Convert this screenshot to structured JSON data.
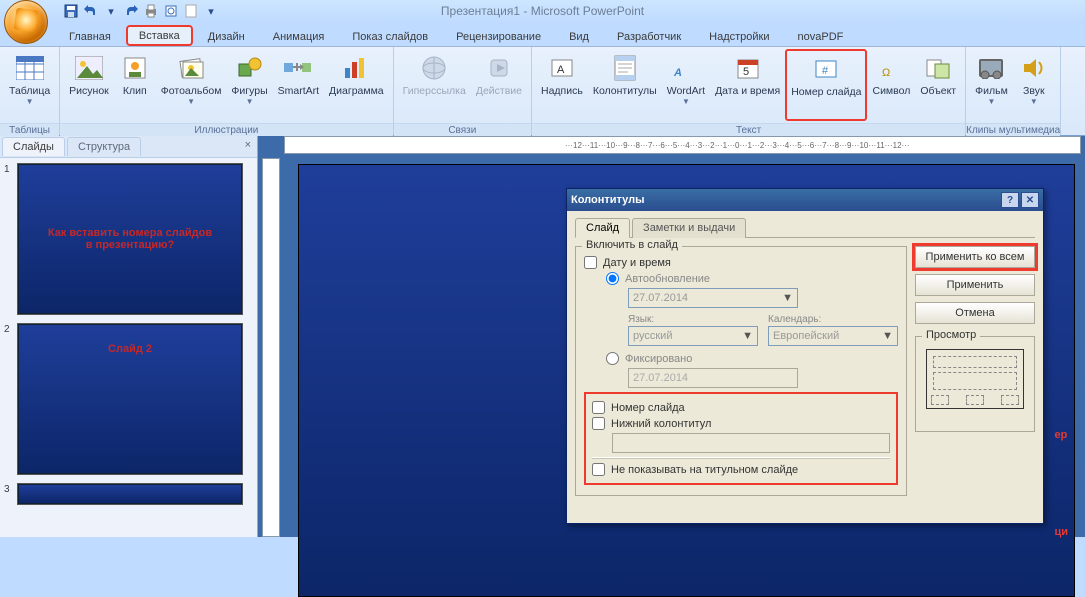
{
  "app_title": "Презентация1 - Microsoft PowerPoint",
  "tabs": {
    "home": "Главная",
    "insert": "Вставка",
    "design": "Дизайн",
    "anim": "Анимация",
    "show": "Показ слайдов",
    "review": "Рецензирование",
    "view": "Вид",
    "dev": "Разработчик",
    "addins": "Надстройки",
    "nova": "novaPDF"
  },
  "groups": {
    "tables": "Таблицы",
    "illust": "Иллюстрации",
    "links": "Связи",
    "text": "Текст",
    "media": "Клипы мультимедиа"
  },
  "ribbon": {
    "table": "Таблица",
    "picture": "Рисунок",
    "clip": "Клип",
    "album": "Фотоальбом",
    "shapes": "Фигуры",
    "smartart": "SmartArt",
    "chart": "Диаграмма",
    "hyperlink": "Гиперссылка",
    "action": "Действие",
    "textbox": "Надпись",
    "headerfooter": "Колонтитулы",
    "wordart": "WordArt",
    "datetime": "Дата и время",
    "slidenum": "Номер слайда",
    "symbol": "Символ",
    "object": "Объект",
    "movie": "Фильм",
    "sound": "Звук"
  },
  "sidepane": {
    "slides": "Слайды",
    "outline": "Структура"
  },
  "thumbs": [
    {
      "n": "1",
      "text": "Как вставить номера слайдов\nв презентацию?"
    },
    {
      "n": "2",
      "text": "Слайд 2"
    },
    {
      "n": "3",
      "text": ""
    }
  ],
  "ruler_h": "···12···11···10···9···8···7···6···5···4···3···2···1···0···1···2···3···4···5···6···7···8···9···10···11···12···",
  "slide_big": {
    "line1": "ер",
    "line2": "ци"
  },
  "dialog": {
    "title": "Колонтитулы",
    "tab_slide": "Слайд",
    "tab_notes": "Заметки и выдачи",
    "include": "Включить в слайд",
    "datetime": "Дату и время",
    "autoupdate": "Автообновление",
    "date_value": "27.07.2014",
    "lang_lbl": "Язык:",
    "cal_lbl": "Календарь:",
    "lang_val": "русский",
    "cal_val": "Европейский",
    "fixed": "Фиксировано",
    "fixed_val": "27.07.2014",
    "slidenum": "Номер слайда",
    "footer": "Нижний колонтитул",
    "notitle": "Не показывать на титульном слайде",
    "apply_all": "Применить ко всем",
    "apply": "Применить",
    "cancel": "Отмена",
    "preview": "Просмотр"
  },
  "chart_data": null
}
